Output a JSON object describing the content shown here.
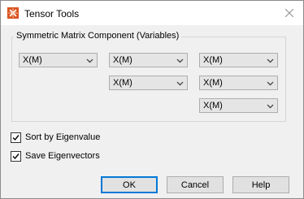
{
  "window": {
    "title": "Tensor Tools",
    "icon": "tensor-tools-app-icon",
    "close_icon": "close-icon"
  },
  "group": {
    "label": "Symmetric Matrix Component (Variables)",
    "dropdowns": [
      "X(M)",
      "X(M)",
      "X(M)",
      "X(M)",
      "X(M)",
      "X(M)"
    ]
  },
  "options": {
    "sort_by_eigenvalue": {
      "label": "Sort by Eigenvalue",
      "checked": true
    },
    "save_eigenvectors": {
      "label": "Save Eigenvectors",
      "checked": true
    }
  },
  "buttons": {
    "ok": "OK",
    "cancel": "Cancel",
    "help": "Help"
  },
  "colors": {
    "dialog_bg": "#f0f0f0",
    "default_button_border": "#0078d7",
    "app_icon": "#d9531e"
  }
}
